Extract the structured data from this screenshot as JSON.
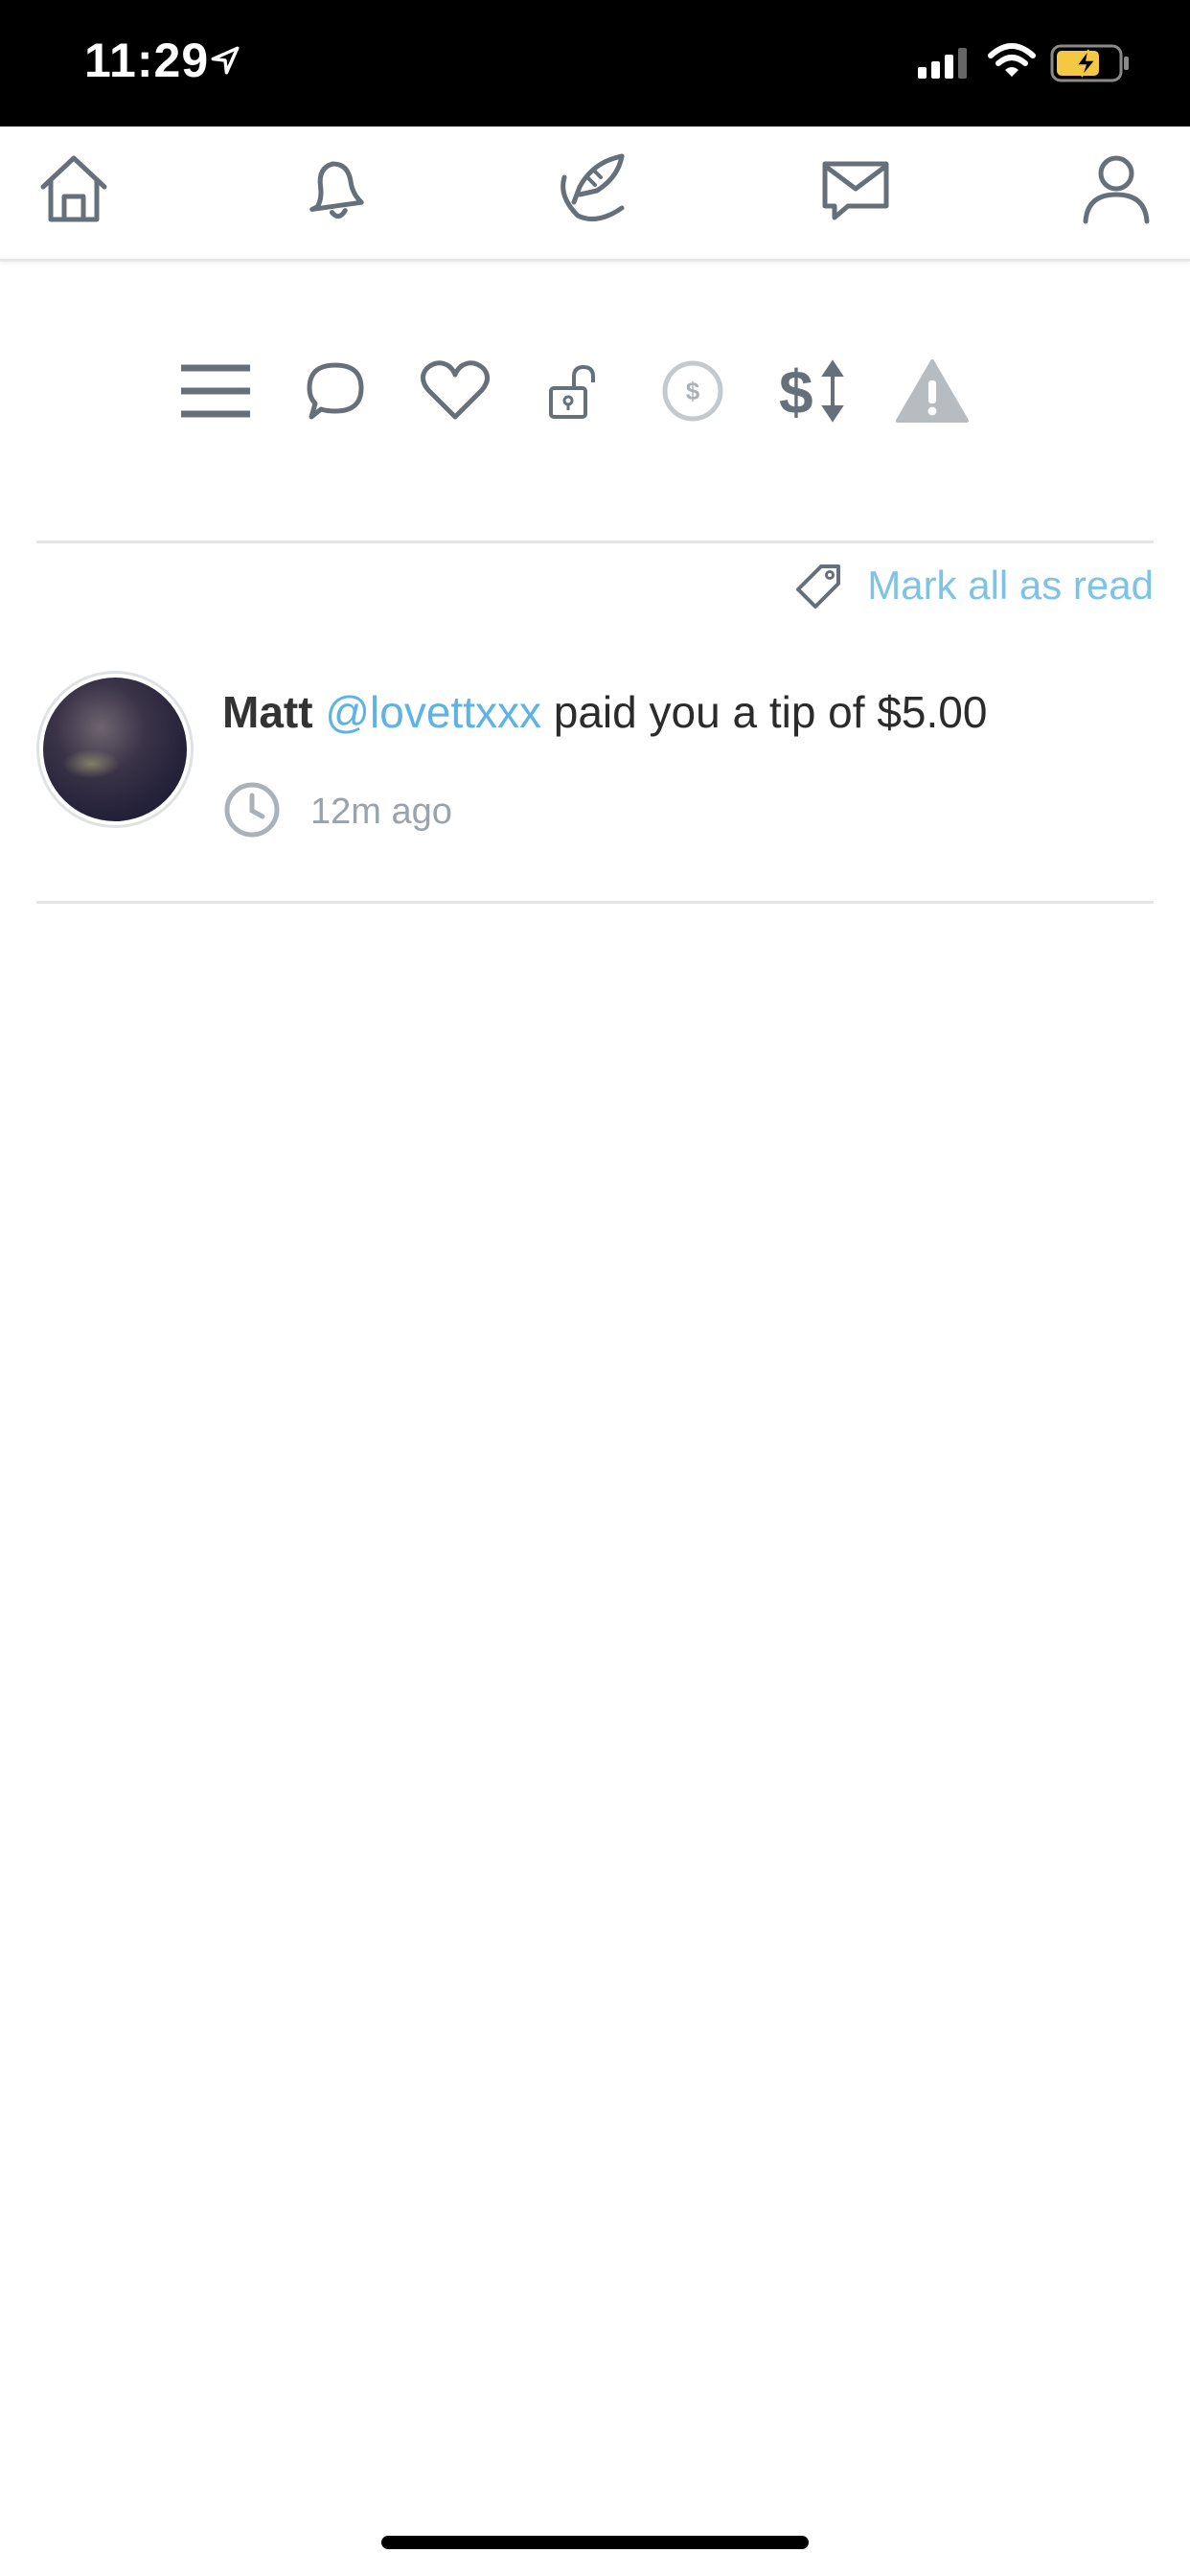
{
  "status_bar": {
    "time": "11:29"
  },
  "nav": {
    "items": [
      {
        "icon": "home-icon"
      },
      {
        "icon": "bell-icon"
      },
      {
        "icon": "quill-icon"
      },
      {
        "icon": "envelope-icon"
      },
      {
        "icon": "user-icon"
      }
    ]
  },
  "filters": {
    "items": [
      {
        "icon": "menu-icon"
      },
      {
        "icon": "comment-icon"
      },
      {
        "icon": "heart-icon"
      },
      {
        "icon": "unlock-icon"
      },
      {
        "icon": "dollar-circle-icon"
      },
      {
        "icon": "dollar-sort-icon"
      },
      {
        "icon": "warning-icon"
      }
    ]
  },
  "mark_all_read": "Mark all as read",
  "notification": {
    "name": "Matt",
    "handle": "@lovettxxx",
    "message": " paid you a tip of $5.00",
    "time": "12m ago"
  },
  "colors": {
    "accent": "#5fb3e4",
    "icon": "#66707a",
    "muted": "#9aa3ab"
  }
}
